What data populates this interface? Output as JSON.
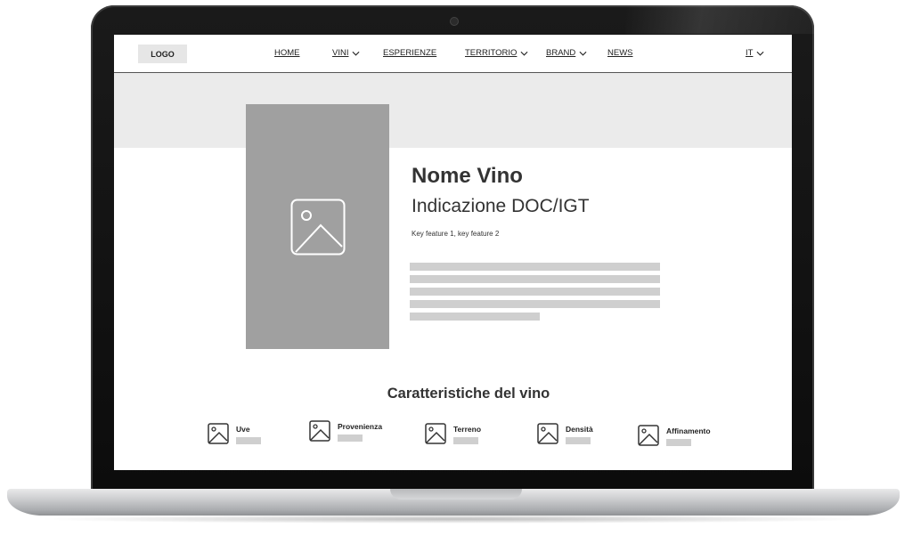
{
  "header": {
    "logo": "LOGO",
    "nav": [
      {
        "label": "HOME",
        "dropdown": false
      },
      {
        "label": "VINI",
        "dropdown": true
      },
      {
        "label": "ESPERIENZE",
        "dropdown": false
      },
      {
        "label": "TERRITORIO",
        "dropdown": true
      },
      {
        "label": "BRAND",
        "dropdown": true
      },
      {
        "label": "NEWS",
        "dropdown": false
      }
    ],
    "language": "IT"
  },
  "product": {
    "image_icon": "image-placeholder-icon",
    "name": "Nome Vino",
    "indication": "Indicazione DOC/IGT",
    "features": "Key feature 1, key feature 2"
  },
  "characteristics": {
    "title": "Caratteristiche del vino",
    "items": [
      {
        "label": "Uve",
        "icon": "image-icon"
      },
      {
        "label": "Provenienza",
        "icon": "image-icon"
      },
      {
        "label": "Terreno",
        "icon": "image-icon"
      },
      {
        "label": "Densità",
        "icon": "image-icon"
      },
      {
        "label": "Affinamento",
        "icon": "image-icon"
      }
    ]
  },
  "colors": {
    "placeholder_gray": "#a0a0a0",
    "hero_band": "#ebebeb",
    "text_line": "#cfcfcf",
    "text": "#333333"
  }
}
